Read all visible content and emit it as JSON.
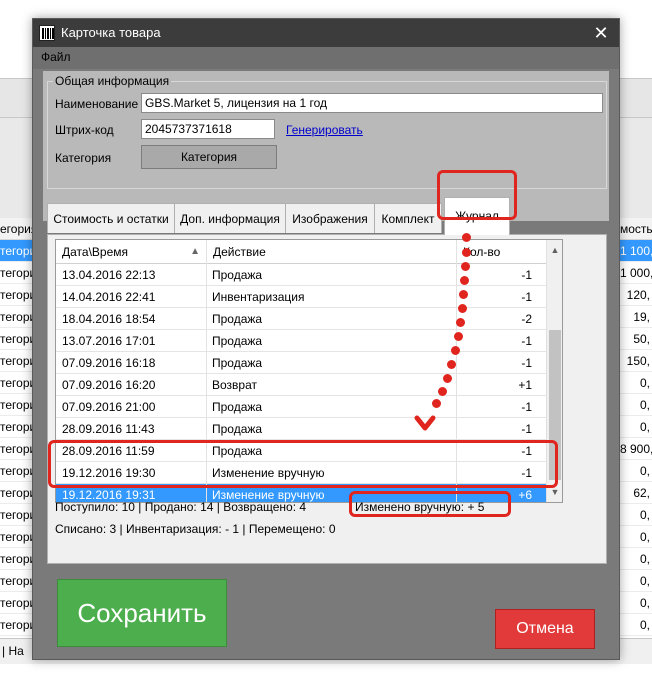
{
  "background": {
    "left_header": "егория",
    "left_rows": [
      "тегория",
      "тегория",
      "тегория",
      "тегория",
      "тегория",
      "тегория",
      "тегория",
      "тегория",
      "тегория",
      "тегория",
      "тегория",
      "тегория",
      "тегория",
      "тегория",
      "тегория",
      "тегория",
      "тегория",
      "тегория",
      "тегория"
    ],
    "right_header": "мость",
    "right_rows": [
      "1 100,",
      "1 000,",
      "120,",
      "19,",
      "50,",
      "150,",
      "0,",
      "0,",
      "0,",
      "8 900,",
      "0,",
      "62,",
      "0,",
      "0,",
      "0,",
      "0,",
      "0,",
      "0,",
      "0,"
    ],
    "status_text": "| На"
  },
  "dialog": {
    "title": "Карточка товара",
    "close_glyph": "✕",
    "menu_file": "Файл",
    "group_title": "Общая информация",
    "name_label": "Наименование",
    "name_value": "GBS.Market 5, лицензия на 1 год",
    "barcode_label": "Штрих-код",
    "barcode_value": "2045737371618",
    "generate_link": "Генерировать",
    "category_label": "Категория",
    "category_button": "Категория"
  },
  "tabs": [
    {
      "label": "Стоимость и остатки"
    },
    {
      "label": "Доп. информация"
    },
    {
      "label": "Изображения"
    },
    {
      "label": "Комплект"
    },
    {
      "label": "Журнал"
    }
  ],
  "grid": {
    "col_date": "Дата\\Время",
    "col_action": "Действие",
    "col_qty": "Кол-во",
    "sort_icon": "sort-ascending-icon",
    "rows": [
      {
        "date": "13.04.2016 22:13",
        "action": "Продажа",
        "qty": "-1"
      },
      {
        "date": "14.04.2016 22:41",
        "action": "Инвентаризация",
        "qty": "-1"
      },
      {
        "date": "18.04.2016 18:54",
        "action": "Продажа",
        "qty": "-2"
      },
      {
        "date": "13.07.2016 17:01",
        "action": "Продажа",
        "qty": "-1"
      },
      {
        "date": "07.09.2016 16:18",
        "action": "Продажа",
        "qty": "-1"
      },
      {
        "date": "07.09.2016 16:20",
        "action": "Возврат",
        "qty": "+1"
      },
      {
        "date": "07.09.2016 21:00",
        "action": "Продажа",
        "qty": "-1"
      },
      {
        "date": "28.09.2016 11:43",
        "action": "Продажа",
        "qty": "-1"
      },
      {
        "date": "28.09.2016 11:59",
        "action": "Продажа",
        "qty": "-1"
      },
      {
        "date": "19.12.2016 19:30",
        "action": "Изменение вручную",
        "qty": "-1"
      },
      {
        "date": "19.12.2016 19:31",
        "action": "Изменение вручную",
        "qty": "+6"
      }
    ],
    "selected_row": 10
  },
  "totals": {
    "received": "Поступило:  10  | Продано:   14  | Возвращено:   4",
    "manual": "Изменено вручную:   + 5",
    "written_off": "Списано:   3  | Инвентаризация:   - 1  | Перемещено:   0"
  },
  "buttons": {
    "save": "Сохранить",
    "cancel": "Отмена"
  },
  "colors": {
    "annotation": "#e0241e",
    "selection": "#3399ff",
    "save": "#4cae4c",
    "cancel": "#e23a3a"
  }
}
